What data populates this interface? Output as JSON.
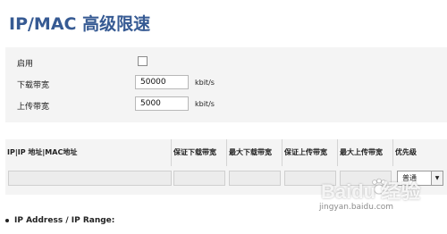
{
  "page": {
    "title": "IP/MAC 高级限速"
  },
  "form": {
    "enable_label": "启用",
    "enable_checked": false,
    "download_label": "下载带宽",
    "download_value": "50000",
    "download_unit": "kbit/s",
    "upload_label": "上传带宽",
    "upload_value": "5000",
    "upload_unit": "kbit/s"
  },
  "table": {
    "columns": [
      "IP|IP 地址|MAC地址",
      "保证下载带宽",
      "最大下载带宽",
      "保证上传带宽",
      "最大上传带宽",
      "优先级"
    ],
    "row": {
      "priority_selected": "普通"
    }
  },
  "info": {
    "bullet": "IP Address / IP Range:"
  },
  "watermark": {
    "main": "Baidu 经验",
    "sub": "jingyan.baidu.com"
  },
  "icons": {
    "checkbox": "checkbox-icon",
    "dropdown": "chevron-down-icon",
    "paw": "baidu-paw-icon"
  }
}
